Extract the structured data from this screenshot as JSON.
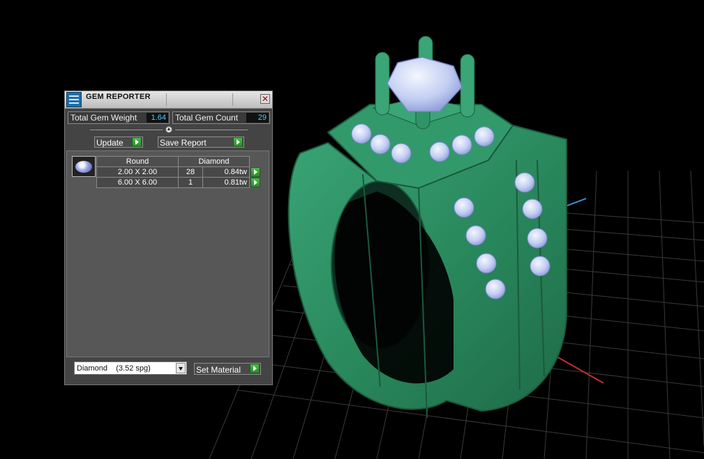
{
  "window": {
    "title": "GEM REPORTER",
    "close_icon": "close-icon"
  },
  "summary": {
    "weight_label": "Total Gem Weight",
    "weight_value": "1.64",
    "count_label": "Total Gem Count",
    "count_value": "29"
  },
  "buttons": {
    "update": "Update",
    "save_report": "Save Report",
    "set_material": "Set Material"
  },
  "gem_table": {
    "headers": [
      "Round",
      "Diamond"
    ],
    "rows": [
      {
        "size": "2.00 X 2.00",
        "count": "28",
        "weight": "0.84tw"
      },
      {
        "size": "6.00 X 6.00",
        "count": "1",
        "weight": "0.81tw"
      }
    ]
  },
  "material": {
    "selected": "Diamond    (3.52 spg)"
  },
  "colors": {
    "ring": "#2c8a5e",
    "gem": "#c8d4f5",
    "accent_value": "#3fd3ff",
    "go_button": "#3aa33a"
  }
}
